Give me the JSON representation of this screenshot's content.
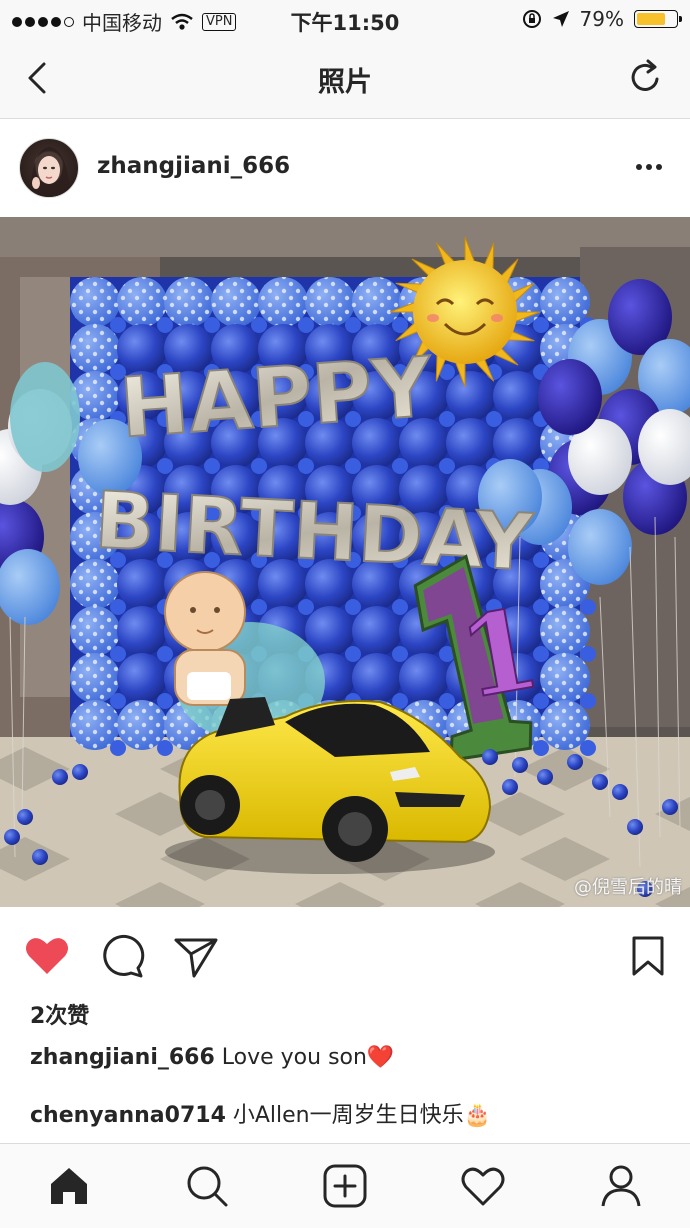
{
  "status_bar": {
    "carrier": "中国移动",
    "vpn": "VPN",
    "time": "下午11:50",
    "battery": "79%",
    "battery_level": 0.79
  },
  "nav": {
    "title": "照片",
    "back_icon": "chevron-left-icon",
    "refresh_icon": "refresh-icon"
  },
  "post": {
    "username": "zhangjiani_666",
    "photo_text_line1": "HAPPY",
    "photo_text_line2": "BIRTHDAY",
    "balloon_number": "1",
    "likes": "2次赞",
    "caption": {
      "user": "zhangjiani_666",
      "text": " Love you son❤️"
    },
    "comments": [
      {
        "user": "chenyanna0714",
        "text": " 小Allen一周岁生日快乐🎂"
      }
    ]
  },
  "tabbar": {
    "items": [
      "home-icon",
      "search-icon",
      "add-icon",
      "heart-icon",
      "profile-icon"
    ]
  },
  "watermark": "@倪雪后的晴"
}
